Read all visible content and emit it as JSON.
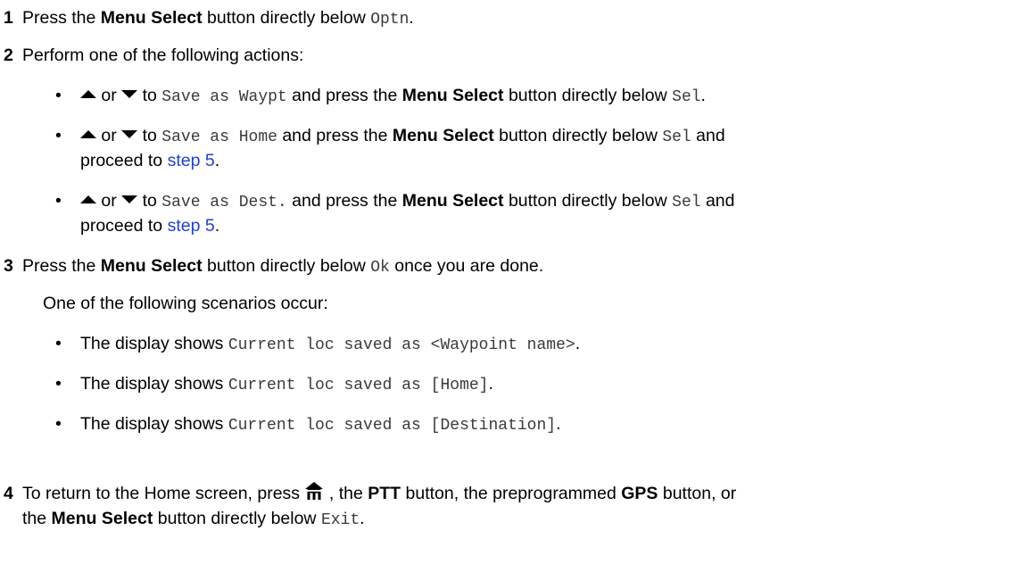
{
  "step1": {
    "number": "1",
    "pre": "Press the ",
    "bold": "Menu Select",
    "mid": " button directly below ",
    "mono": "Optn",
    "end": "."
  },
  "step2": {
    "number": "2",
    "text": "Perform one of the following actions:",
    "options": [
      {
        "or": " or ",
        "to": " to ",
        "mono": "Save as Waypt",
        "a": " and press the ",
        "bold": "Menu Select",
        "b": " button directly below ",
        "sel": "Sel",
        "end": "."
      },
      {
        "or": " or ",
        "to": " to ",
        "mono": "Save as Home",
        "a": " and press the ",
        "bold": "Menu Select",
        "b": " button directly below ",
        "sel": "Sel",
        "and": " and",
        "cont_pre": "proceed to ",
        "link": "step 5",
        "end": "."
      },
      {
        "or": " or ",
        "to": " to ",
        "mono": "Save as Dest.",
        "a": " and press the ",
        "bold": "Menu Select",
        "b": " button directly below ",
        "sel": "Sel",
        "and": " and",
        "cont_pre": "proceed to ",
        "link": "step 5",
        "end": "."
      }
    ]
  },
  "step3": {
    "number": "3",
    "pre": "Press the ",
    "bold": "Menu Select",
    "mid": " button directly below ",
    "mono": "Ok",
    "end": " once you are done.",
    "scenario_intro": "One of the following scenarios occur:",
    "scenarios": [
      {
        "pre": "The display shows ",
        "mono": "Current loc saved as <Waypoint name>",
        "end": "."
      },
      {
        "pre": "The display shows ",
        "mono": "Current loc saved as [Home]",
        "end": "."
      },
      {
        "pre": "The display shows ",
        "mono": "Current loc saved as [Destination]",
        "end": "."
      }
    ]
  },
  "step4": {
    "number": "4",
    "pre": "To return to the Home screen, press ",
    "a": " , the ",
    "ptt": "PTT",
    "b": " button, the preprogrammed ",
    "gps": "GPS",
    "c": " button, or",
    "line2_pre": "the ",
    "bold": "Menu Select",
    "line2_mid": " button directly below ",
    "mono": "Exit",
    "end": "."
  },
  "bullet": "•",
  "icons": {
    "up": "up-arrow-icon",
    "down": "down-arrow-icon",
    "home": "home-icon"
  }
}
